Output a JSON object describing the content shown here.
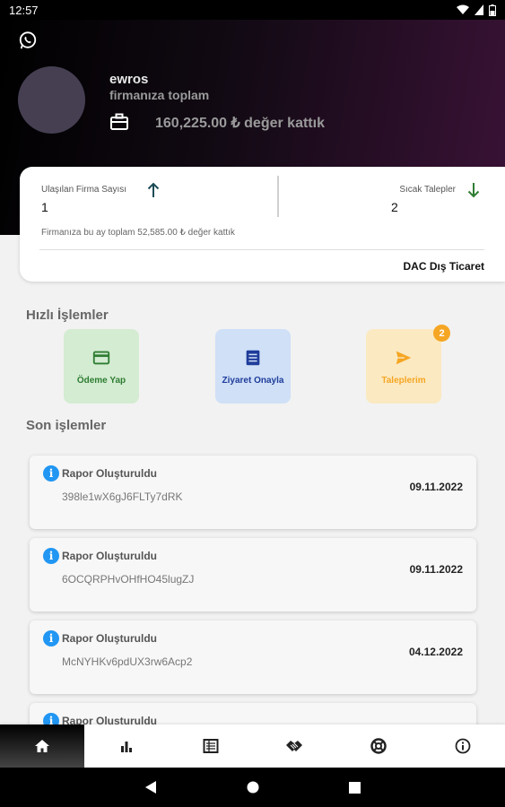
{
  "status_bar": {
    "time": "12:57"
  },
  "profile": {
    "name": "ewros",
    "subtitle": "firmanıza toplam",
    "total_value": "160,225.00 ₺ değer kattık"
  },
  "stats": {
    "left_label": "Ulaşılan Firma Sayısı",
    "left_value": "1",
    "right_label": "Sıcak Talepler",
    "right_value": "2",
    "month_text": "Firmanıza bu ay toplam 52,585.00 ₺ değer kattık",
    "company": "DAC Dış Ticaret"
  },
  "quick_actions": {
    "title": "Hızlı İşlemler",
    "items": [
      {
        "label": "Ödeme Yap",
        "icon": "credit-card-icon",
        "bg": "#d4ecd2",
        "color": "#2e7d32"
      },
      {
        "label": "Ziyaret Onayla",
        "icon": "list-icon",
        "bg": "#cfe0f7",
        "color": "#1f3c9a"
      },
      {
        "label": "Taleplerim",
        "icon": "send-icon",
        "bg": "#fbe9c2",
        "color": "#f5a623",
        "badge": "2"
      }
    ]
  },
  "recent": {
    "title": "Son işlemler",
    "items": [
      {
        "title": "Rapor Oluşturuldu",
        "code": "398le1wX6gJ6FLTy7dRK",
        "date": "09.11.2022"
      },
      {
        "title": "Rapor Oluşturuldu",
        "code": "6OCQRPHvOHfHO45lugZJ",
        "date": "09.11.2022"
      },
      {
        "title": "Rapor Oluşturuldu",
        "code": "McNYHKv6pdUX3rw6Acp2",
        "date": "04.12.2022"
      },
      {
        "title": "Rapor Oluşturuldu",
        "code": "",
        "date": ""
      }
    ]
  },
  "nav": {
    "items": [
      "home-icon",
      "bar-chart-icon",
      "report-icon",
      "handshake-icon",
      "support-icon",
      "info-icon"
    ]
  },
  "colors": {
    "accent_green": "#2e7d32",
    "accent_blue": "#2196f3",
    "accent_orange": "#f5a623"
  }
}
